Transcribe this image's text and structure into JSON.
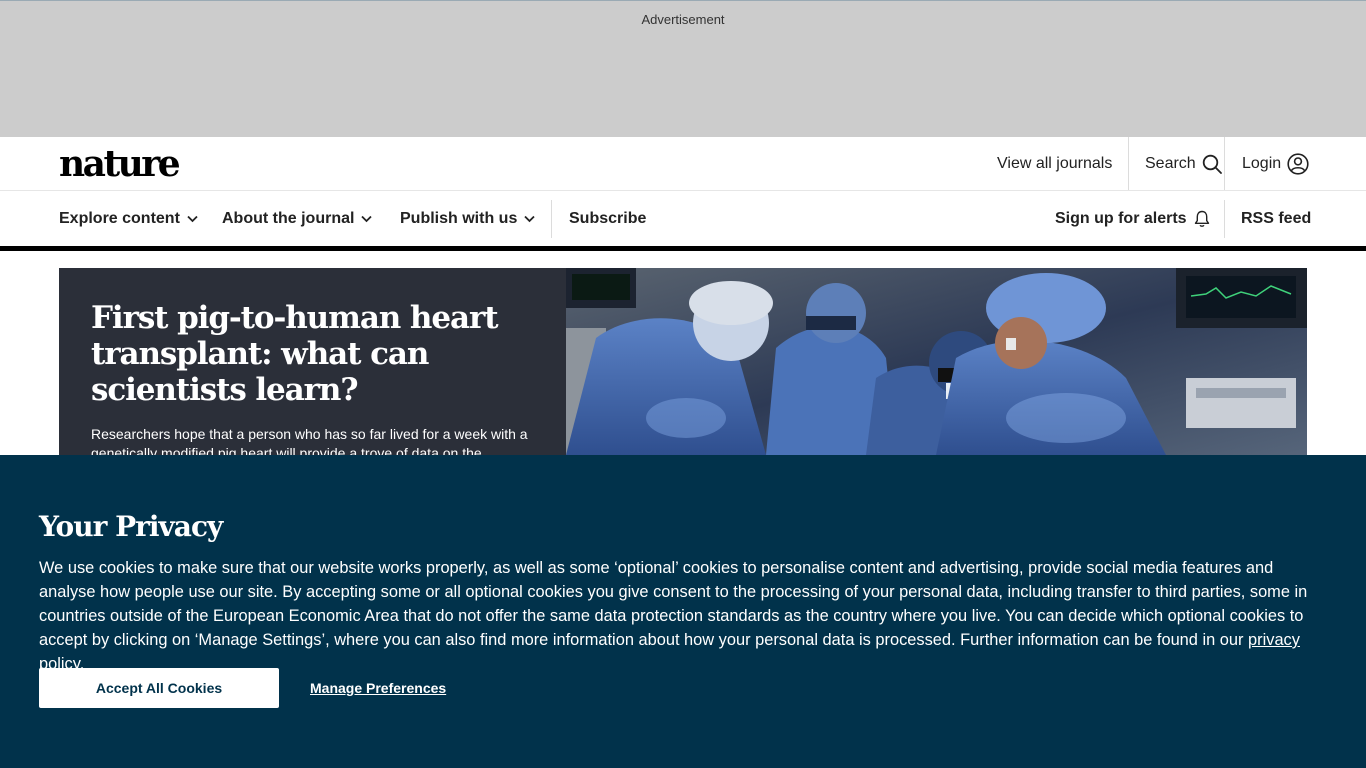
{
  "ad": {
    "label": "Advertisement"
  },
  "header": {
    "logo": "nature",
    "view_all_journals": "View all journals",
    "search": "Search",
    "login": "Login",
    "icons": {
      "search": "search-icon",
      "login": "user-icon",
      "dropdown": "chevron-down-icon",
      "alerts": "bell-icon"
    }
  },
  "nav": {
    "explore": "Explore content",
    "about": "About the journal",
    "publish": "Publish with us",
    "subscribe": "Subscribe",
    "alerts": "Sign up for alerts",
    "rss": "RSS feed"
  },
  "hero": {
    "title": "First pig-to-human heart transplant: what can scientists learn?",
    "summary": "Researchers hope that a person who has so far lived for a week with a genetically modified pig heart will provide a trove of data on the"
  },
  "cookie": {
    "title": "Your Privacy",
    "text": "We use cookies to make sure that our website works properly, as well as some ‘optional’ cookies to personalise content and advertising, provide social media features and analyse how people use our site. By accepting some or all optional cookies you give consent to the processing of your personal data, including transfer to third parties, some in countries outside of the European Economic Area that do not offer the same data protection standards as the country where you live. You can decide which optional cookies to accept by clicking on ‘Manage Settings’, where you can also find more information about how your personal data is processed. Further information can be found in our ",
    "policy_link": "privacy policy",
    "text_end": ".",
    "accept": "Accept All Cookies",
    "manage": "Manage Preferences"
  },
  "colors": {
    "banner": "#01324b",
    "hero_panel": "#2b2f39",
    "ad_bg": "#cccccc"
  }
}
